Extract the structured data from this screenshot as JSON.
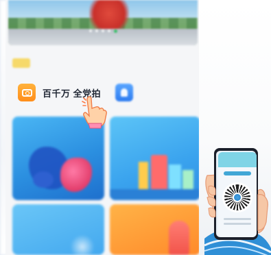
{
  "main_screen": {
    "quick_entries": [
      {
        "label": "百千万 全党拍",
        "icon": "camera-icon",
        "color": "#ff9a21"
      },
      {
        "label": "",
        "icon": "id-card-icon",
        "color": "#2d7bf0"
      }
    ],
    "banner": {
      "dot_count": 5,
      "active_dot": 4
    }
  },
  "colors": {
    "banner_accent": "#c8302a",
    "card_blue": "#2b8fe0",
    "card_orange": "#ff8a2a",
    "qr_header": "#7fd4e6"
  }
}
